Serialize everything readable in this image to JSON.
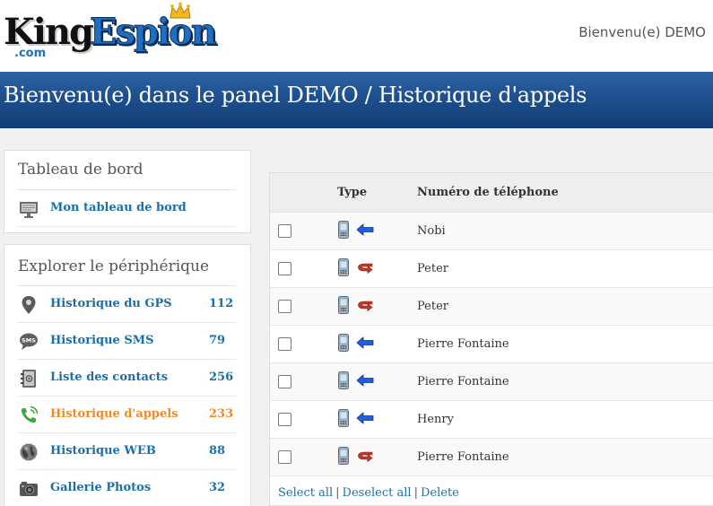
{
  "header": {
    "logo": {
      "word1": "King",
      "word2": "Espion",
      "suffix": ".com"
    },
    "welcome": "Bienvenu(e) DEMO"
  },
  "banner": {
    "title": "Bienvenu(e) dans le panel DEMO / Historique d'appels"
  },
  "dashboard_panel": {
    "title": "Tableau de bord",
    "items": [
      {
        "label": "Mon tableau de bord",
        "icon": "monitor-icon"
      }
    ]
  },
  "device_panel": {
    "title": "Explorer le périphérique",
    "items": [
      {
        "label": "Historique du GPS",
        "count": "112",
        "icon": "map-pin-icon"
      },
      {
        "label": "Historique SMS",
        "count": "79",
        "icon": "sms-bubble-icon"
      },
      {
        "label": "Liste des contacts",
        "count": "256",
        "icon": "address-book-icon"
      },
      {
        "label": "Historique d'appels",
        "count": "233",
        "icon": "phone-call-icon",
        "active": true
      },
      {
        "label": "Historique WEB",
        "count": "88",
        "icon": "globe-icon"
      },
      {
        "label": "Gallerie Photos",
        "count": "32",
        "icon": "camera-icon"
      }
    ]
  },
  "calls_table": {
    "headers": {
      "type": "Type",
      "number": "Numéro de téléphone"
    },
    "rows": [
      {
        "direction": "incoming",
        "number": "Nobi"
      },
      {
        "direction": "missed",
        "number": "Peter"
      },
      {
        "direction": "missed",
        "number": "Peter"
      },
      {
        "direction": "incoming",
        "number": "Pierre Fontaine"
      },
      {
        "direction": "incoming",
        "number": "Pierre Fontaine"
      },
      {
        "direction": "incoming",
        "number": "Henry"
      },
      {
        "direction": "missed",
        "number": "Pierre Fontaine"
      }
    ],
    "actions": {
      "select_all": "Select all",
      "deselect_all": "Deselect all",
      "delete": "Delete",
      "separator": "|"
    }
  },
  "colors": {
    "banner": "#1d4d8b",
    "link": "#1a6fa8",
    "active": "#f08a24"
  }
}
